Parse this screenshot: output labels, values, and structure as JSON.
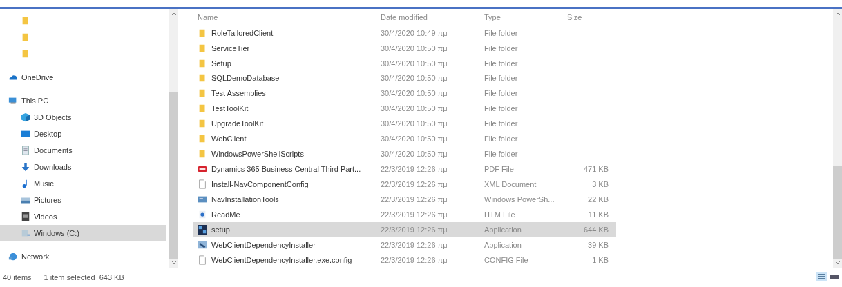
{
  "sidebar": {
    "items": [
      {
        "kind": "folder",
        "selected": false
      },
      {
        "kind": "folder",
        "selected": false
      },
      {
        "kind": "folder",
        "selected": false
      },
      {
        "label": "OneDrive",
        "kind": "cloud",
        "selected": false
      },
      {
        "label": "This PC",
        "kind": "pc",
        "selected": false,
        "children": [
          {
            "label": "3D Objects",
            "kind": "cube",
            "selected": false
          },
          {
            "label": "Desktop",
            "kind": "desktop",
            "selected": false
          },
          {
            "label": "Documents",
            "kind": "document",
            "selected": false
          },
          {
            "label": "Downloads",
            "kind": "download",
            "selected": false
          },
          {
            "label": "Music",
            "kind": "music",
            "selected": false
          },
          {
            "label": "Pictures",
            "kind": "pictures",
            "selected": false
          },
          {
            "label": "Videos",
            "kind": "video",
            "selected": false
          },
          {
            "label": "Windows (C:)",
            "kind": "drive",
            "selected": true
          }
        ]
      },
      {
        "label": "Network",
        "kind": "network",
        "selected": false
      }
    ]
  },
  "table": {
    "columns": [
      "Name",
      "Date modified",
      "Type",
      "Size"
    ],
    "rows": [
      {
        "name": "RoleTailoredClient",
        "date": "30/4/2020 10:49 πμ",
        "type": "File folder",
        "kind": "folder",
        "selected": false
      },
      {
        "name": "ServiceTier",
        "date": "30/4/2020 10:50 πμ",
        "type": "File folder",
        "kind": "folder",
        "selected": false
      },
      {
        "name": "Setup",
        "date": "30/4/2020 10:50 πμ",
        "type": "File folder",
        "kind": "folder",
        "selected": false
      },
      {
        "name": "SQLDemoDatabase",
        "date": "30/4/2020 10:50 πμ",
        "type": "File folder",
        "kind": "folder",
        "selected": false
      },
      {
        "name": "Test Assemblies",
        "date": "30/4/2020 10:50 πμ",
        "type": "File folder",
        "kind": "folder",
        "selected": false
      },
      {
        "name": "TestToolKit",
        "date": "30/4/2020 10:50 πμ",
        "type": "File folder",
        "kind": "folder",
        "selected": false
      },
      {
        "name": "UpgradeToolKit",
        "date": "30/4/2020 10:50 πμ",
        "type": "File folder",
        "kind": "folder",
        "selected": false
      },
      {
        "name": "WebClient",
        "date": "30/4/2020 10:50 πμ",
        "type": "File folder",
        "kind": "folder",
        "selected": false
      },
      {
        "name": "WindowsPowerShellScripts",
        "date": "30/4/2020 10:50 πμ",
        "type": "File folder",
        "kind": "folder",
        "selected": false
      },
      {
        "name": "Dynamics 365 Business Central Third Part...",
        "date": "22/3/2019 12:26 πμ",
        "type": "PDF File",
        "size": "471 KB",
        "kind": "pdf",
        "selected": false
      },
      {
        "name": "Install-NavComponentConfig",
        "date": "22/3/2019 12:26 πμ",
        "type": "XML Document",
        "size": "3 KB",
        "kind": "blank",
        "selected": false
      },
      {
        "name": "NavInstallationTools",
        "date": "22/3/2019 12:26 πμ",
        "type": "Windows PowerSh...",
        "size": "22 KB",
        "kind": "script",
        "selected": false
      },
      {
        "name": "ReadMe",
        "date": "22/3/2019 12:26 πμ",
        "type": "HTM File",
        "size": "11 KB",
        "kind": "web",
        "selected": false
      },
      {
        "name": "setup",
        "date": "22/3/2019 12:26 πμ",
        "type": "Application",
        "size": "644 KB",
        "kind": "app",
        "selected": true
      },
      {
        "name": "WebClientDependencyInstaller",
        "date": "22/3/2019 12:26 πμ",
        "type": "Application",
        "size": "39 KB",
        "kind": "installer",
        "selected": false
      },
      {
        "name": "WebClientDependencyInstaller.exe.config",
        "date": "22/3/2019 12:26 πμ",
        "type": "CONFIG File",
        "size": "1 KB",
        "kind": "blank",
        "selected": false
      }
    ]
  },
  "status_bar": {
    "items": "40 items",
    "selection": "1 item selected  643 KB"
  }
}
